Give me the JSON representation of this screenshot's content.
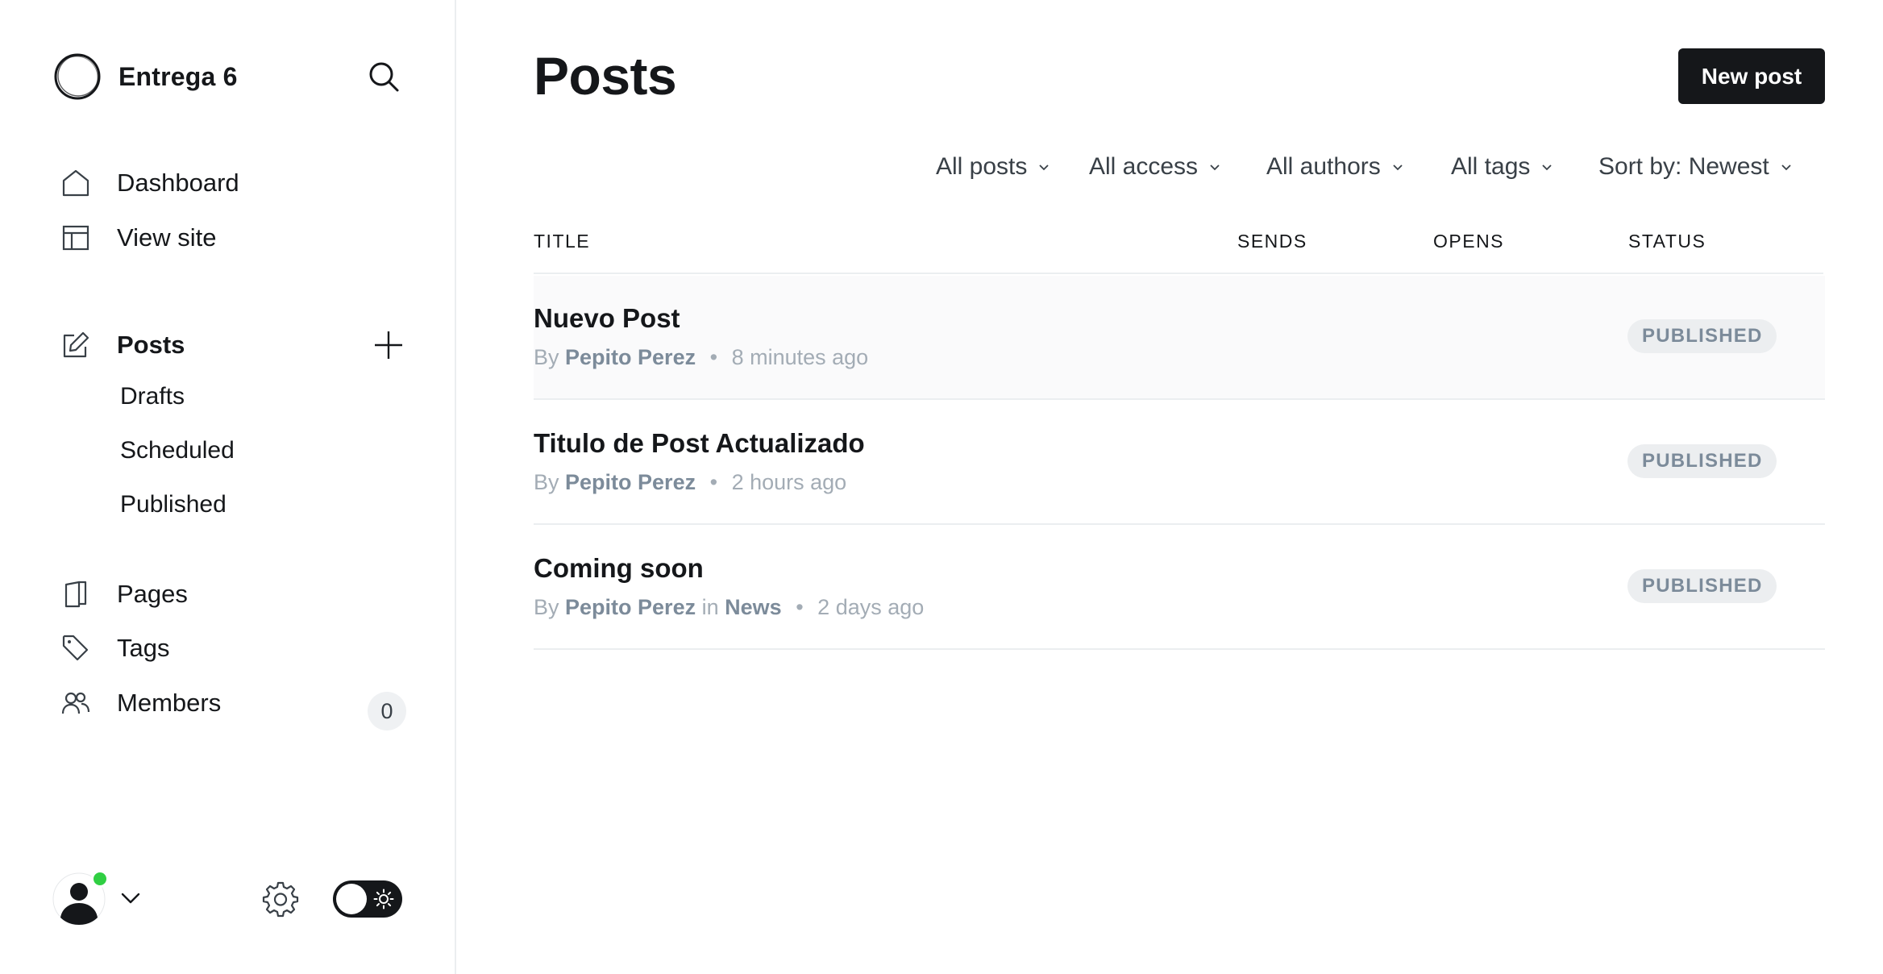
{
  "brand": {
    "name": "Entrega 6",
    "logo_icon": "circle-logo-icon"
  },
  "sidebar": {
    "search_icon": "search-icon",
    "nav_top": [
      {
        "label": "Dashboard",
        "icon": "home-icon"
      },
      {
        "label": "View site",
        "icon": "layout-icon"
      }
    ],
    "posts": {
      "label": "Posts",
      "icon": "edit-icon",
      "add_icon": "plus-icon",
      "sub_items": [
        "Drafts",
        "Scheduled",
        "Published"
      ]
    },
    "nav_bottom": [
      {
        "label": "Pages",
        "icon": "book-icon"
      },
      {
        "label": "Tags",
        "icon": "tag-icon"
      },
      {
        "label": "Members",
        "icon": "members-icon",
        "count": "0"
      }
    ],
    "footer": {
      "avatar_icon": "user-avatar-icon",
      "status_color": "#30cf43",
      "chevron_icon": "chevron-down-icon",
      "settings_icon": "gear-icon",
      "theme_toggle_icon": "sun-icon"
    }
  },
  "main": {
    "title": "Posts",
    "new_post_label": "New post",
    "filters": [
      "All posts",
      "All access",
      "All authors",
      "All tags",
      "Sort by: Newest"
    ],
    "columns": [
      "TITLE",
      "SENDS",
      "OPENS",
      "STATUS"
    ],
    "posts": [
      {
        "title": "Nuevo Post",
        "by": "By",
        "author": "Pepito Perez",
        "in": "",
        "tag": "",
        "sep": "•",
        "time": "8 minutes ago",
        "status": "PUBLISHED"
      },
      {
        "title": "Titulo de Post Actualizado",
        "by": "By",
        "author": "Pepito Perez",
        "in": "",
        "tag": "",
        "sep": "•",
        "time": "2 hours ago",
        "status": "PUBLISHED"
      },
      {
        "title": "Coming soon",
        "by": "By",
        "author": "Pepito Perez",
        "in": "in",
        "tag": "News",
        "sep": "•",
        "time": "2 days ago",
        "status": "PUBLISHED"
      }
    ]
  },
  "colors": {
    "accent_dark": "#15171a",
    "muted": "#a3acb5",
    "status_pill_bg": "#eceef0",
    "online": "#30cf43"
  }
}
